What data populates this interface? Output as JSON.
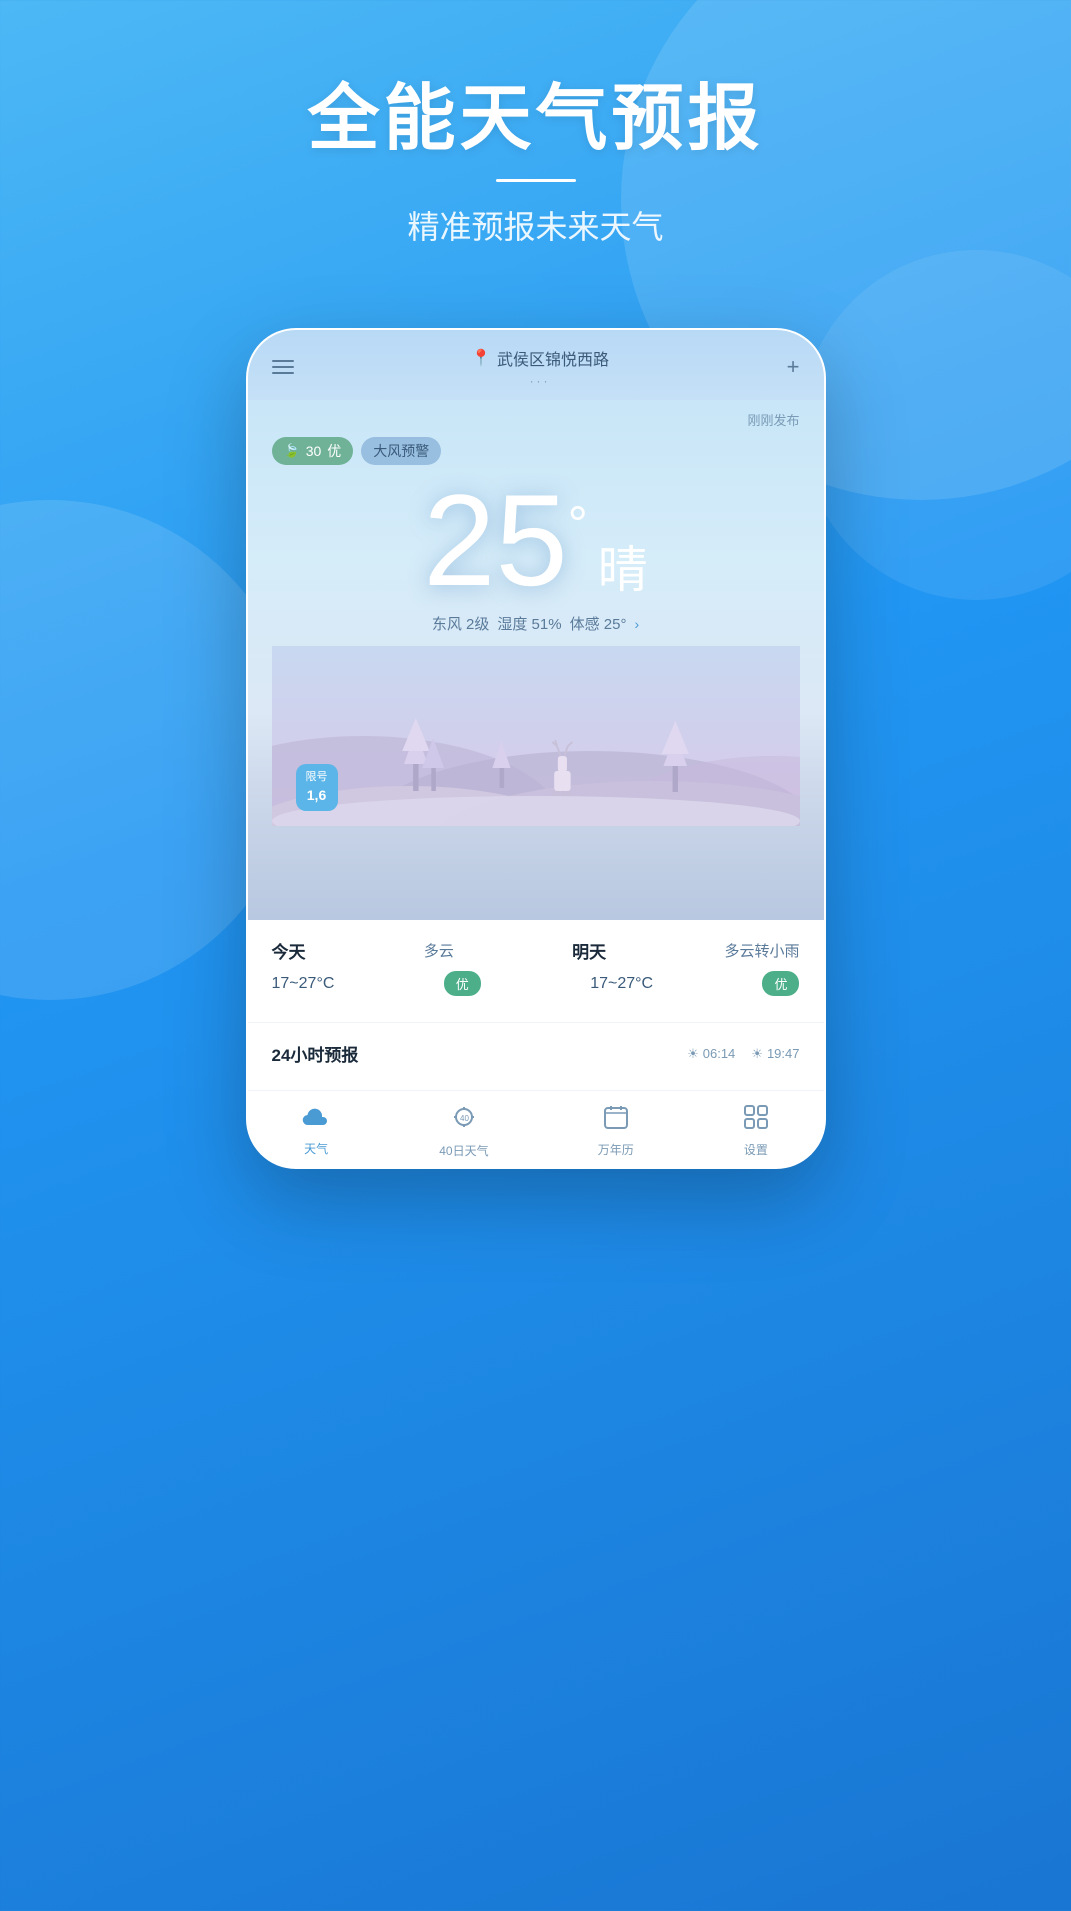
{
  "header": {
    "main_title": "全能天气预报",
    "divider": true,
    "subtitle": "精准预报未来天气"
  },
  "phone": {
    "topbar": {
      "location": "武侯区锦悦西路",
      "location_dots": "···",
      "add_label": "+"
    },
    "weather": {
      "just_published": "刚刚发布",
      "aqi_value": "30",
      "aqi_level": "优",
      "warning": "大风预警",
      "temperature": "25",
      "degree_symbol": "°",
      "condition": "晴",
      "wind": "东风 2级",
      "humidity": "湿度 51%",
      "feels_like": "体感 25°",
      "detail_arrow": "›"
    },
    "limit_badge": {
      "label": "限号",
      "numbers": "1,6"
    },
    "forecast": {
      "today": {
        "day": "今天",
        "condition": "多云",
        "temp": "17~27°C",
        "quality": "优"
      },
      "tomorrow": {
        "day": "明天",
        "condition": "多云转小雨",
        "temp": "17~27°C",
        "quality": "优"
      }
    },
    "hourly": {
      "title": "24小时预报",
      "sunrise": "06:14",
      "sunset": "19:47"
    },
    "bottom_nav": [
      {
        "id": "weather",
        "label": "天气",
        "active": true,
        "icon": "cloud"
      },
      {
        "id": "forecast40",
        "label": "40日天气",
        "active": false,
        "icon": "sun40"
      },
      {
        "id": "calendar",
        "label": "万年历",
        "active": false,
        "icon": "calendar"
      },
      {
        "id": "settings",
        "label": "设置",
        "active": false,
        "icon": "grid"
      }
    ]
  }
}
